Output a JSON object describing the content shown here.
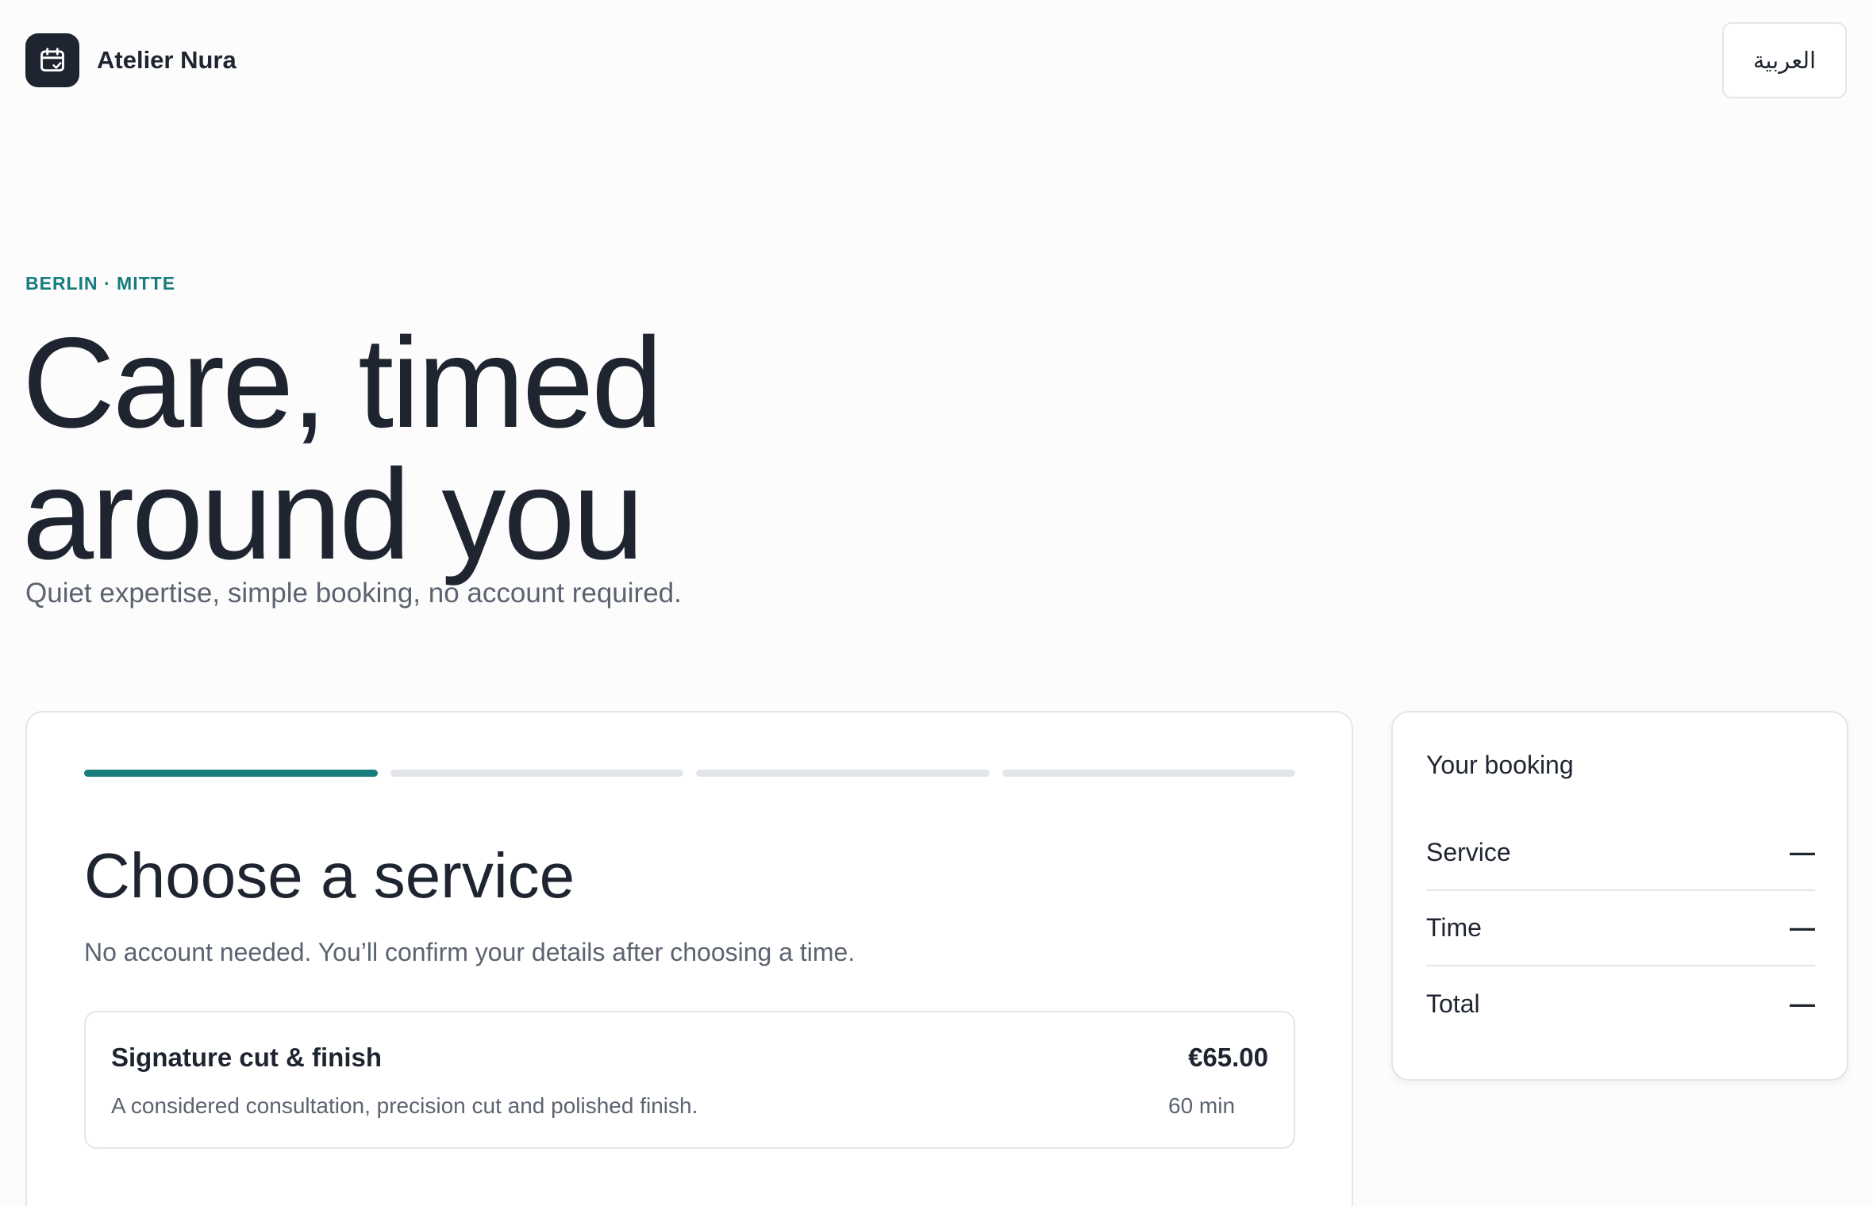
{
  "brand": {
    "name": "Atelier Nura",
    "logo_icon": "calendar-check-icon"
  },
  "language_toggle": {
    "label": "العربية"
  },
  "hero": {
    "eyebrow": "BERLIN · MITTE",
    "title_line1": "Care, timed",
    "title_line2": "around you",
    "subtitle": "Quiet expertise, simple booking, no account required."
  },
  "booking": {
    "progress": {
      "total_steps": 4,
      "current_step": 1
    },
    "title": "Choose a service",
    "subtitle": "No account needed. You’ll confirm your details after choosing a time.",
    "services": [
      {
        "name": "Signature cut & finish",
        "description": "A considered consultation, precision cut and polished finish.",
        "price": "€65.00",
        "duration": "60 min"
      }
    ]
  },
  "summary": {
    "title": "Your booking",
    "rows": [
      {
        "label": "Service",
        "value": "—"
      },
      {
        "label": "Time",
        "value": "—"
      },
      {
        "label": "Total",
        "value": "—"
      }
    ]
  },
  "colors": {
    "accent": "#167c7c",
    "text": "#1f2530",
    "muted": "#5c6370",
    "border": "#e2e5ea",
    "background": "#fcfcfc"
  }
}
